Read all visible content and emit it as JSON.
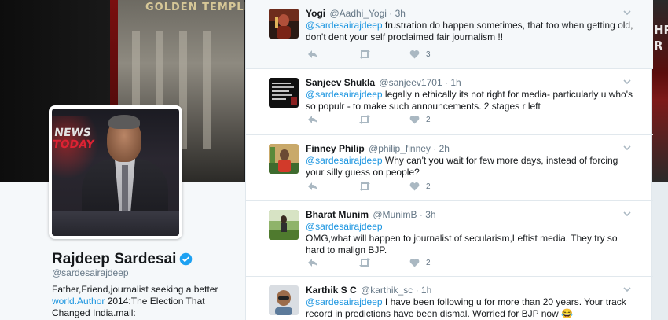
{
  "background": {
    "banner_caption": "GOLDEN TEMPLE",
    "right_text": "HR\nR",
    "avatar_text_line1": "NEWS",
    "avatar_text_line2": "TODAY"
  },
  "profile": {
    "name": "Rajdeep Sardesai",
    "handle": "@sardesairajdeep",
    "bio_line1": "Father,Friend,journalist seeking a better",
    "bio_link": "world.Author",
    "bio_line2_rest": " 2014:The Election That",
    "bio_line3": "Changed India.mail:"
  },
  "tweets": [
    {
      "name": "Yogi",
      "handle": "@Aadhi_Yogi",
      "sep": "·",
      "time": "3h",
      "mention": "@sardesairajdeep",
      "text": " frustration do happen sometimes, that too when getting old, don't dent your self proclaimed fair journalism !!",
      "likes": "3"
    },
    {
      "name": "Sanjeev Shukla",
      "handle": "@sanjeev1701",
      "sep": "·",
      "time": "1h",
      "mention": "@sardesairajdeep",
      "text": " legally n ethically its not right for media- particularly u who's so populr - to make such announcements. 2 stages r left",
      "likes": "2"
    },
    {
      "name": "Finney Philip",
      "handle": "@philip_finney",
      "sep": "·",
      "time": "2h",
      "mention": "@sardesairajdeep",
      "text": " Why can't you wait for few more days, instead of forcing your silly guess on people?",
      "likes": "2"
    },
    {
      "name": "Bharat Munim",
      "handle": "@MunimB",
      "sep": "·",
      "time": "3h",
      "mention": "@sardesairajdeep",
      "text": "OMG,what will happen to journalist of secularism,Leftist media. They try so hard to malign BJP.",
      "likes": "2"
    },
    {
      "name": "Karthik S C",
      "handle": "@karthik_sc",
      "sep": "·",
      "time": "1h",
      "mention": "@sardesairajdeep",
      "text": " I have been following u for more than 20 years. Your track record in predictions have been dismal. Worried for BJP now 😂",
      "likes": ""
    }
  ],
  "icons": {
    "reply": "reply-icon",
    "retweet": "retweet-icon",
    "like": "heart-icon",
    "more": "chevron-down-icon",
    "verified": "verified-badge-icon"
  },
  "colors": {
    "link": "#1b95e0",
    "muted": "#657786",
    "text": "#14171a",
    "highlight_row": "#f5f8fa"
  }
}
